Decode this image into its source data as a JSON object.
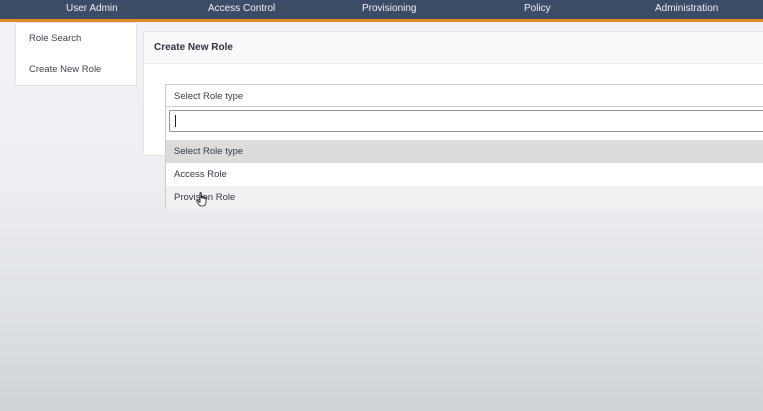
{
  "topnav": {
    "items": [
      {
        "label": "User Admin"
      },
      {
        "label": "Access Control"
      },
      {
        "label": "Provisioning"
      },
      {
        "label": "Policy"
      },
      {
        "label": "Administration"
      }
    ]
  },
  "sidebar": {
    "items": [
      {
        "label": "Role Search"
      },
      {
        "label": "Create New Role"
      }
    ]
  },
  "panel": {
    "title": "Create New Role"
  },
  "role_type_select": {
    "selected_value": "Select Role type",
    "search_value": "",
    "options": [
      {
        "label": "Select Role type",
        "state": "selected"
      },
      {
        "label": "Access Role",
        "state": "normal"
      },
      {
        "label": "Provision Role",
        "state": "hovered"
      }
    ]
  },
  "icons": {
    "pointer": "hand-pointer-icon"
  },
  "colors": {
    "nav_background": "#3b4d66",
    "nav_accent": "#e0892b",
    "selected_option": "#dcdcdc"
  }
}
